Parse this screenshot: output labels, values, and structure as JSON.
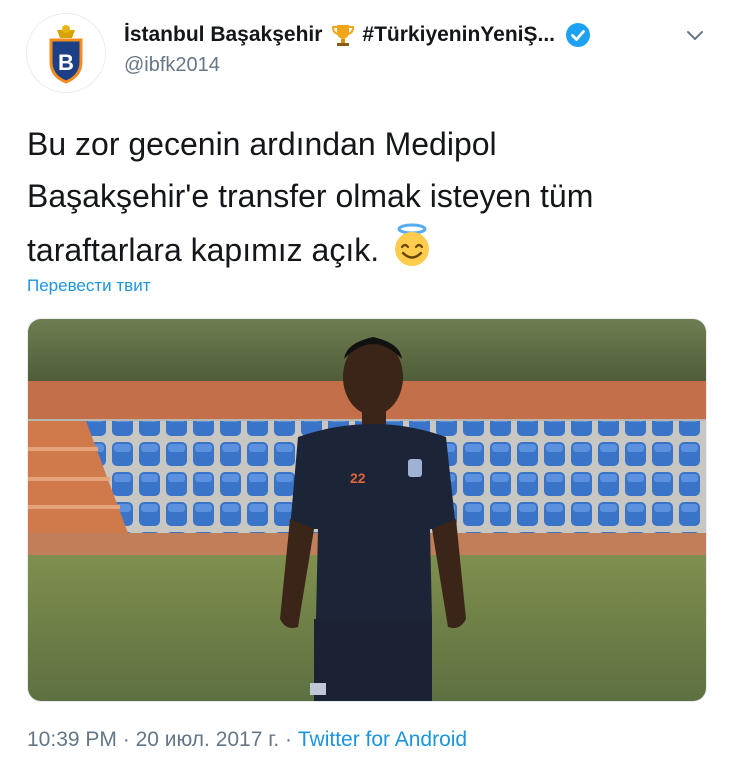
{
  "account": {
    "display_name": "İstanbul Başakşehir",
    "hashtag": "#TürkiyeninYeniŞ...",
    "handle": "@ibfk2014",
    "avatar_icon": "basaksehir-crest-icon"
  },
  "tweet": {
    "text_line1": "Bu zor gecenin ardından Medipol",
    "text_line2": "Başakşehir'e transfer olmak isteyen tüm",
    "text_line3": "taraftarlara kapımız açık.",
    "emoji": "smiling-face-with-halo-icon",
    "translate_label": "Перевести твит",
    "media": {
      "description_icon": "photo-football-player",
      "jersey_number": "22"
    },
    "time": "10:39 PM",
    "separator": " · ",
    "date": "20 июл. 2017 г.",
    "separator2": " · ",
    "client": "Twitter for Android"
  },
  "colors": {
    "link": "#1b95e0",
    "secondary_text": "#657786",
    "verified": "#1da1f2"
  }
}
